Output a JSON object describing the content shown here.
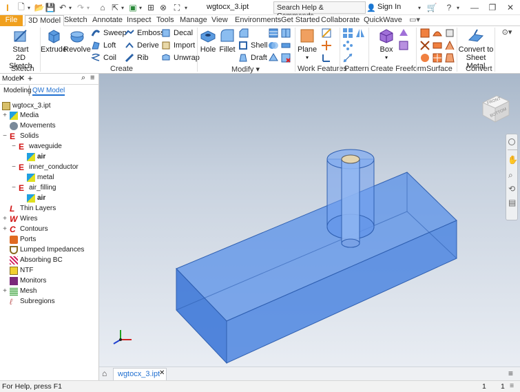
{
  "titlebar": {
    "title": "wgtocx_3.ipt",
    "search_placeholder": "Search Help & Commands...",
    "signin": "Sign In"
  },
  "tabs": [
    "File",
    "3D Model",
    "Sketch",
    "Annotate",
    "Inspect",
    "Tools",
    "Manage",
    "View",
    "Environments",
    "Get Started",
    "Collaborate",
    "QuickWave"
  ],
  "ribbon": {
    "sketch": {
      "start": "Start",
      "start2": "2D Sketch",
      "group": "Sketch"
    },
    "create": {
      "extrude": "Extrude",
      "revolve": "Revolve",
      "sweep": "Sweep",
      "loft": "Loft",
      "coil": "Coil",
      "emboss": "Emboss",
      "derive": "Derive",
      "rib": "Rib",
      "decal": "Decal",
      "import": "Import",
      "unwrap": "Unwrap",
      "group": "Create"
    },
    "modify": {
      "hole": "Hole",
      "fillet": "Fillet",
      "shell": "Shell",
      "draft": "Draft",
      "group": "Modify ▾"
    },
    "work": {
      "plane": "Plane",
      "group": "Work Features"
    },
    "pattern": {
      "group": "Pattern"
    },
    "freeform": {
      "box": "Box",
      "group": "Create Freeform"
    },
    "surface": {
      "group": "Surface"
    },
    "convert": {
      "line1": "Convert to",
      "line2": "Sheet Metal",
      "group": "Convert"
    }
  },
  "panel": {
    "title": "Model",
    "tab_modeling": "Modeling",
    "tab_qw": "QW Model"
  },
  "tree": {
    "root": "wgtocx_3.ipt",
    "items": [
      "Media",
      "Movements",
      "Solids",
      "waveguide",
      "air",
      "inner_conductor",
      "metal",
      "air_filling",
      "air",
      "Thin Layers",
      "Wires",
      "Contours",
      "Ports",
      "Lumped Impedances",
      "Absorbing BC",
      "NTF",
      "Monitors",
      "Mesh",
      "Subregions"
    ]
  },
  "viewcube": {
    "front": "FRONT",
    "bottom": "BOTTOM"
  },
  "doctab": {
    "name": "wgtocx_3.ipt"
  },
  "status": {
    "help": "For Help, press F1",
    "n1": "1",
    "n2": "1"
  },
  "colors": {
    "file_tab": "#f0a01e",
    "solid_blue": "#5b8ee6",
    "accent": "#1f6fd0"
  }
}
